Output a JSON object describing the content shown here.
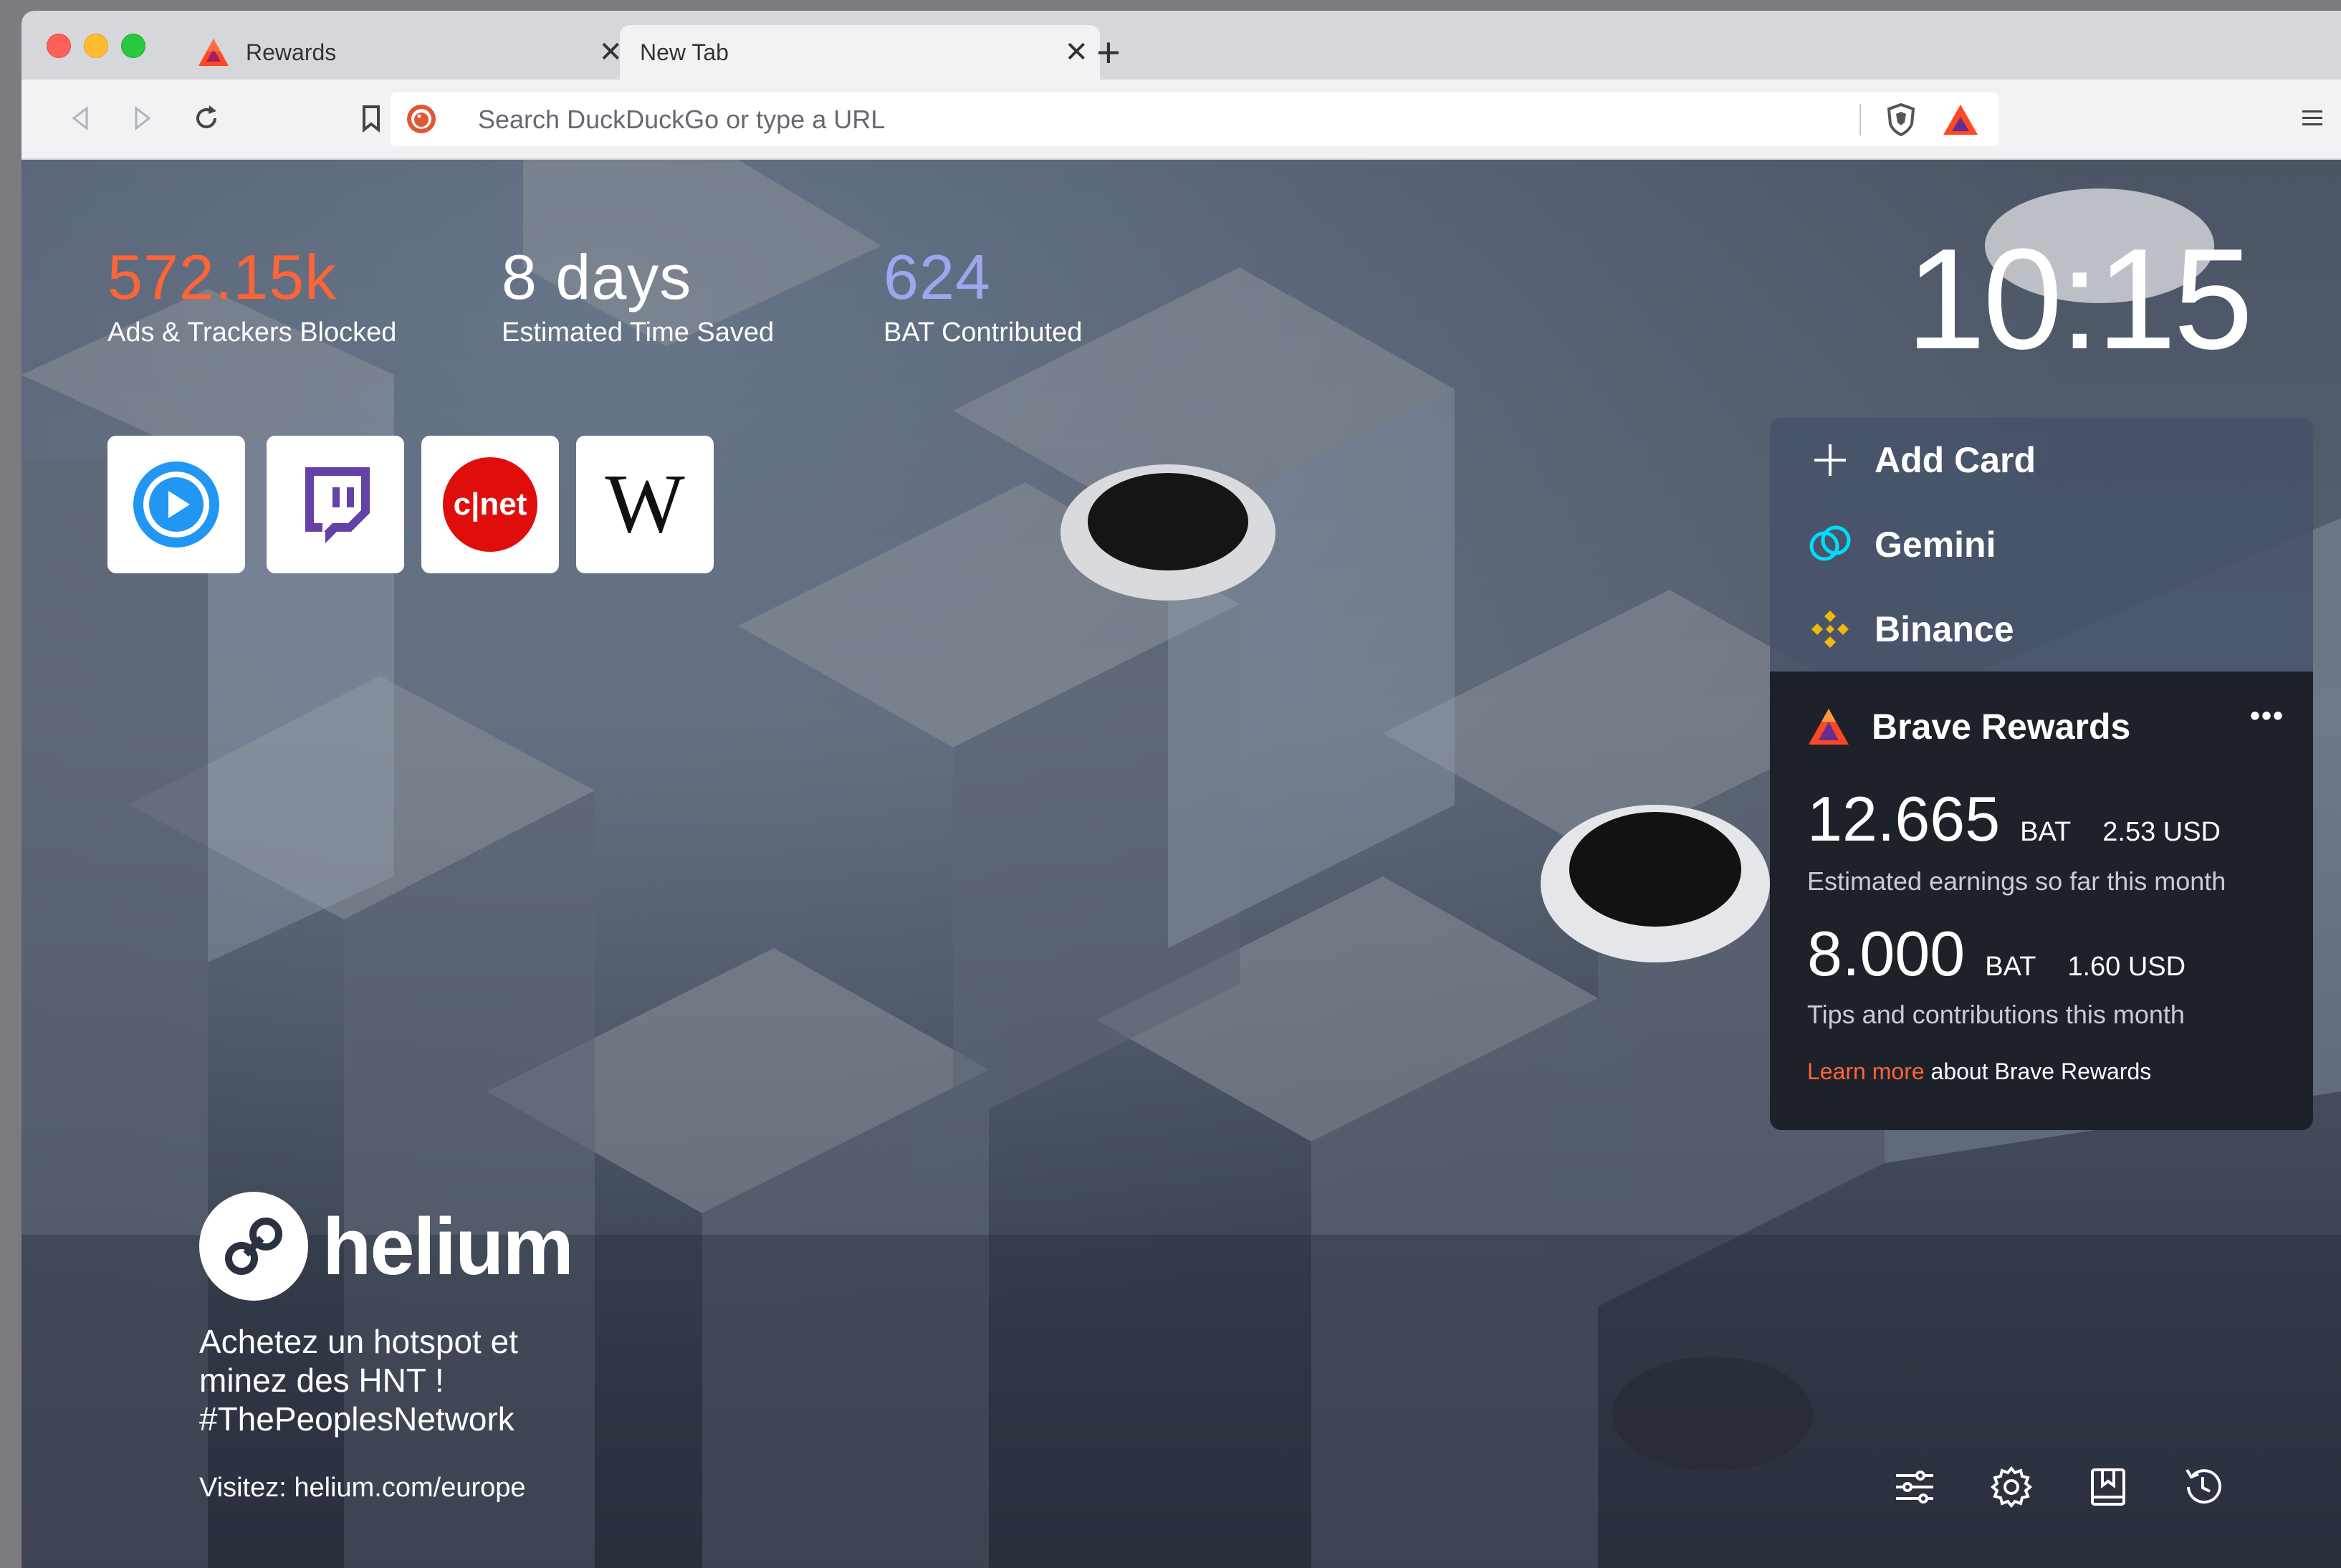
{
  "tabs": [
    {
      "label": "Rewards",
      "close": "✕",
      "active": false
    },
    {
      "label": "New Tab",
      "close": "✕",
      "active": true
    }
  ],
  "new_tab_symbol": "+",
  "toolbar": {
    "back_icon": "back-arrow-icon",
    "forward_icon": "forward-arrow-icon",
    "reload_icon": "reload-icon",
    "bookmark_icon": "bookmark-icon",
    "menu_icon": "hamburger-menu-icon"
  },
  "urlbar": {
    "placeholder": "Search DuckDuckGo or type a URL",
    "search_engine_icon": "duckduckgo-icon",
    "shields_icon": "brave-shield-icon",
    "rewards_icon": "bat-triangle-icon"
  },
  "stats": [
    {
      "value": "572.15k",
      "label": "Ads & Trackers Blocked",
      "color": "#ff6437"
    },
    {
      "value": "8 days",
      "label": "Estimated Time Saved",
      "color": "#ffffff"
    },
    {
      "value": "624",
      "label": "BAT Contributed",
      "color": "#a0a5f0"
    }
  ],
  "clock": "10:15",
  "top_sites": [
    {
      "name": "video-player-site",
      "icon": "play-icon"
    },
    {
      "name": "twitch",
      "icon": "twitch-icon"
    },
    {
      "name": "cnet",
      "icon": "cnet-icon",
      "logo_text": "c|net"
    },
    {
      "name": "wikipedia",
      "icon": "wikipedia-icon",
      "logo_text": "W"
    }
  ],
  "widget_stack": {
    "add_card": "Add Card",
    "gemini": "Gemini",
    "binance": "Binance"
  },
  "rewards": {
    "title": "Brave Rewards",
    "more": "•••",
    "earnings": {
      "amount": "12.665",
      "unit": "BAT",
      "usd": "2.53 USD",
      "caption": "Estimated earnings so far this month"
    },
    "tips": {
      "amount": "8.000",
      "unit": "BAT",
      "usd": "1.60 USD",
      "caption": "Tips and contributions this month"
    },
    "learn_link": "Learn more",
    "learn_rest": " about Brave Rewards"
  },
  "sponsor": {
    "logo_text": "helium",
    "tagline": "Achetez un hotspot et minez des HNT ! #ThePeoplesNetwork",
    "visit_label": "Visitez: ",
    "visit_url": "helium.com/europe"
  },
  "bottom_icons": [
    "customize-sliders-icon",
    "settings-gear-icon",
    "bookmarks-icon",
    "history-icon"
  ],
  "colors": {
    "accent_orange": "#ff6437",
    "bat_purple": "#a0a5f0",
    "card_dark": "#1d2129"
  }
}
